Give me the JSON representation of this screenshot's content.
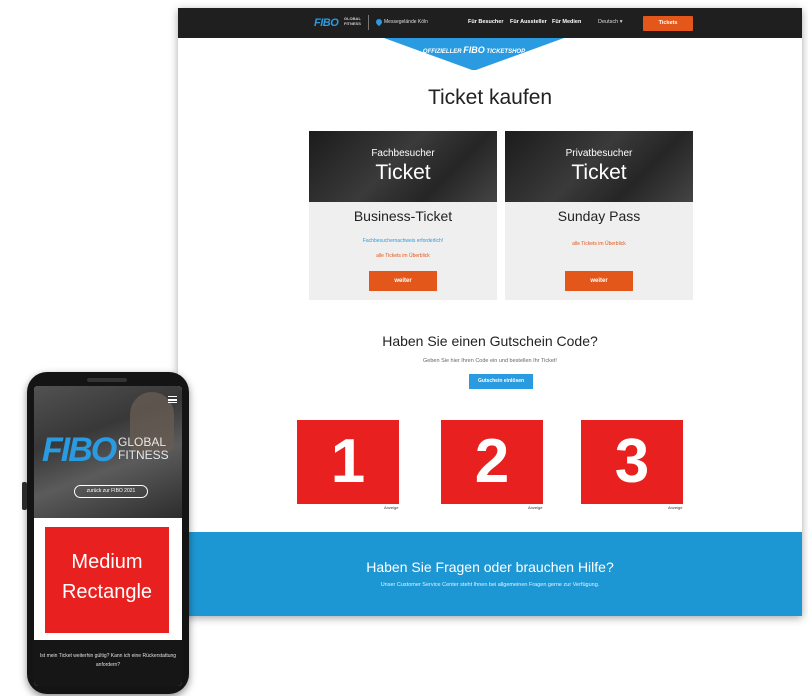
{
  "desktop": {
    "header": {
      "logo": "FIBO",
      "logo_sub_1": "GLOBAL",
      "logo_sub_2": "FITNESS",
      "location": "Messegelände Köln",
      "nav": [
        "Für Besucher",
        "Für Aussteller",
        "Für Medien"
      ],
      "language": "Deutsch ▾",
      "tickets_button": "Tickets"
    },
    "banner": {
      "left": "OFFIZIELLER",
      "logo": "FIBO",
      "right": "TICKETSHOP"
    },
    "title": "Ticket kaufen",
    "cards": [
      {
        "category": "Fachbesucher",
        "ticket": "Ticket",
        "name": "Business-Ticket",
        "links": [
          {
            "text": "Fachbesuchernachweis erforderlich!",
            "color": "blue"
          },
          {
            "text": "alle Tickets im Überblick",
            "color": "red"
          }
        ],
        "button": "weiter"
      },
      {
        "category": "Privatbesucher",
        "ticket": "Ticket",
        "name": "Sunday Pass",
        "links": [
          {
            "text": "alle Tickets im Überblick",
            "color": "red"
          }
        ],
        "button": "weiter"
      }
    ],
    "voucher": {
      "title": "Haben Sie einen Gutschein Code?",
      "subtitle": "Geben Sie hier Ihren Code ein und bestellen Ihr Ticket!",
      "button": "Gutschein einlösen"
    },
    "ads": [
      {
        "number": "1",
        "label": "Anzeige"
      },
      {
        "number": "2",
        "label": "Anzeige"
      },
      {
        "number": "3",
        "label": "Anzeige"
      }
    ],
    "help": {
      "title": "Haben Sie Fragen oder brauchen Hilfe?",
      "subtitle": "Unser Customer Service Center steht Ihnen bei allgemeinen Fragen gerne zur Verfügung."
    }
  },
  "phone": {
    "logo": "FIBO",
    "logo_sub_1": "GLOBAL",
    "logo_sub_2": "FITNESS",
    "pill": "zurück zur FIBO 2021",
    "ad_line_1": "Medium",
    "ad_line_2": "Rectangle",
    "footer_line_1": "Ist mein Ticket weiterhin gültig? Kann ich eine Rückerstattung",
    "footer_line_2": "anfordern?"
  },
  "colors": {
    "accent_orange": "#e4571a",
    "accent_blue": "#2a9be0",
    "help_blue": "#1d97d4",
    "ad_red": "#e8201f",
    "header_dark": "#1f1f1f"
  },
  "icons": [
    "location-pin-icon",
    "dropdown-caret-icon",
    "menu-icon"
  ]
}
